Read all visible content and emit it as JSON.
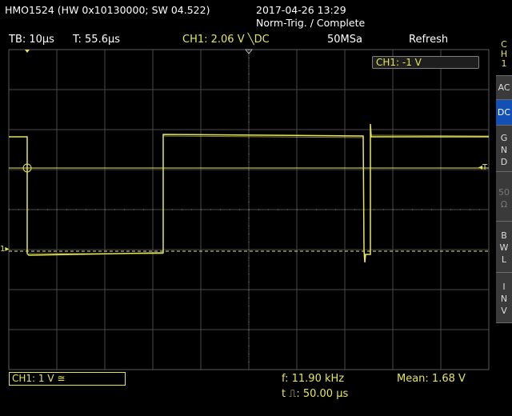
{
  "header": {
    "device": "HMO1524 (HW 0x10130000; SW 04.522)",
    "datetime": "2017-04-26 13:29",
    "status": "Norm-Trig. / Complete"
  },
  "toolbar": {
    "timebase": "TB: 10µs",
    "trigger_time": "T: 55.6µs",
    "trigger_setting": "CH1: 2.06 V ╲DC",
    "sample_rate": "50MSa",
    "mode": "Refresh"
  },
  "overlay": {
    "channel_scale": "CH1: -1 V"
  },
  "side_menu": {
    "channel": [
      "C",
      "H",
      "1"
    ],
    "ac": "AC",
    "dc": "DC",
    "gnd": [
      "G",
      "N",
      "D"
    ],
    "ohm": [
      "50",
      "Ω"
    ],
    "bwl": [
      "B",
      "W",
      "L"
    ],
    "inv": [
      "I",
      "N",
      "V"
    ]
  },
  "markers": {
    "channel_ground": "1",
    "trigger_level": "T"
  },
  "footer": {
    "channel_info": "CH1: 1 V ≅",
    "frequency": "f: 11.90 kHz",
    "pulse_width": "t ⎍: 50.00 µs",
    "mean": "Mean: 1.68 V"
  },
  "colors": {
    "trace": "#e6e65a",
    "grid": "#4a4a4a",
    "accent": "#1450b4",
    "background": "#000000"
  }
}
